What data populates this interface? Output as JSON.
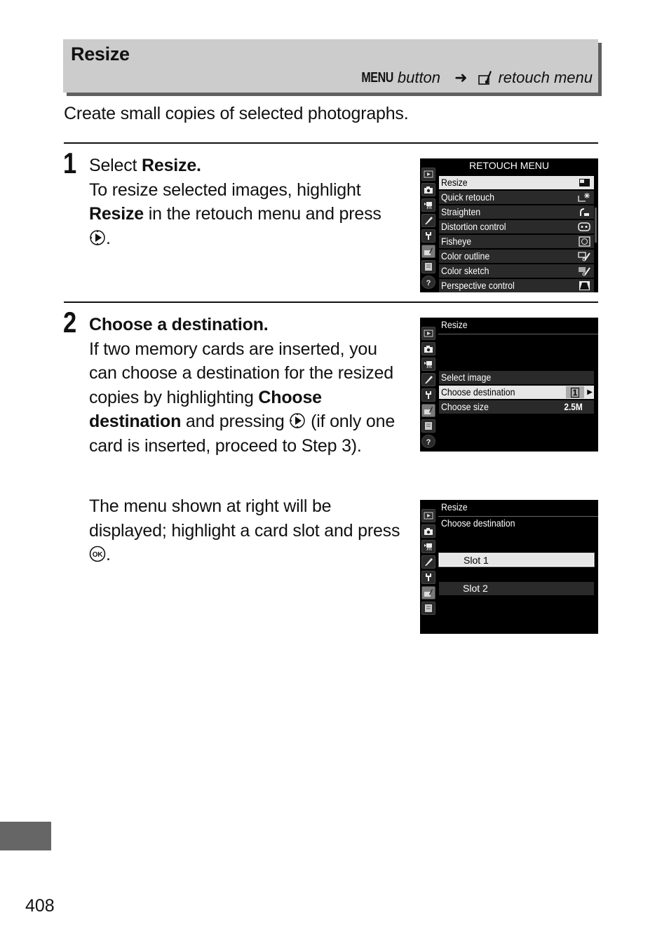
{
  "header": {
    "title": "Resize",
    "menu_button_label": "MENU",
    "button_word": "button",
    "arrow": "➜",
    "destination_menu": "retouch menu",
    "destination_icon": "retouch-menu-icon"
  },
  "intro": "Create small copies of selected photographs.",
  "steps": [
    {
      "number": "1",
      "title_plain": "Select ",
      "title_bold": "Resize.",
      "text_1": "To resize selected images, highlight",
      "bold_1": "Resize",
      "text_2": " in the retouch menu and press",
      "end_icon": "multi-selector-right-icon",
      "end_text": "."
    },
    {
      "number": "2",
      "title": "Choose a destination.",
      "text_1": "If two memory cards are inserted, you can choose a destination for the resized copies by highlighting ",
      "bold_1": "Choose destination",
      "text_2": " and pressing ",
      "icon": "multi-selector-right-icon",
      "text_3": " (if only one card is inserted, proceed to Step 3).",
      "para2_text": "The menu shown at right will be displayed; highlight a card slot and press ",
      "para2_icon": "ok-button-icon",
      "para2_end": "."
    }
  ],
  "screens": {
    "retouch_menu": {
      "title": "RETOUCH MENU",
      "items": [
        {
          "label": "Resize",
          "icon": "resize-icon",
          "selected": true
        },
        {
          "label": "Quick retouch",
          "icon": "quick-retouch-icon",
          "selected": false
        },
        {
          "label": "Straighten",
          "icon": "straighten-icon",
          "selected": false
        },
        {
          "label": "Distortion control",
          "icon": "distortion-control-icon",
          "selected": false
        },
        {
          "label": "Fisheye",
          "icon": "fisheye-icon",
          "selected": false
        },
        {
          "label": "Color outline",
          "icon": "color-outline-icon",
          "selected": false
        },
        {
          "label": "Color sketch",
          "icon": "color-sketch-icon",
          "selected": false
        },
        {
          "label": "Perspective control",
          "icon": "perspective-control-icon",
          "selected": false
        }
      ]
    },
    "resize_menu": {
      "title": "Resize",
      "items": [
        {
          "label": "Select image",
          "value": "",
          "selected": false
        },
        {
          "label": "Choose destination",
          "value": "1",
          "selected": true
        },
        {
          "label": "Choose size",
          "value": "2.5M",
          "selected": false
        }
      ]
    },
    "destination_menu": {
      "title": "Resize",
      "subtitle": "Choose destination",
      "options": [
        {
          "label": "Slot 1",
          "selected": true
        },
        {
          "label": "Slot 2",
          "selected": false
        }
      ]
    },
    "side_tabs": [
      "playback-icon",
      "camera-icon",
      "movie-icon",
      "pencil-icon",
      "wrench-icon",
      "retouch-icon",
      "recent-settings-icon",
      "help-icon"
    ]
  },
  "page_number": "408"
}
